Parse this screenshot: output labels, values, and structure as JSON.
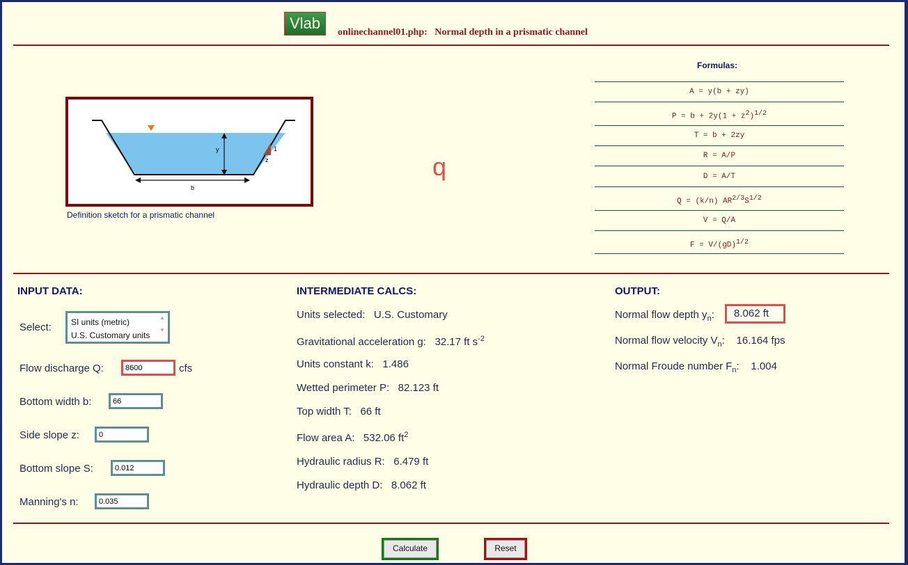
{
  "header": {
    "logo_text": "Vlab",
    "page_file": "onlinechannel01.php:",
    "page_title": "Normal depth in a prismatic channel"
  },
  "sketch": {
    "caption": "Definition sketch for a prismatic channel",
    "label_y": "y",
    "label_b": "b",
    "label_z": "z",
    "label_1": "1"
  },
  "big_symbol": "q",
  "formulas": {
    "title": "Formulas:",
    "rows": [
      {
        "main": "A = y(b + zy)"
      },
      {
        "main": "P = b + 2y(1 + z",
        "sup": "2",
        "tail": ")",
        "sup2": "1/2"
      },
      {
        "main": "T = b + 2zy"
      },
      {
        "main": "R = A/P"
      },
      {
        "main": "D = A/T"
      },
      {
        "main": "Q = (k/n) AR",
        "sup": "2/3",
        "tail": "S",
        "sup2": "1/2"
      },
      {
        "main": "V = Q/A"
      },
      {
        "main": "F = V/(gD)",
        "sup": "1/2"
      }
    ]
  },
  "input": {
    "title": "INPUT DATA:",
    "select_label": "Select:",
    "unit_options": [
      "SI units (metric)",
      "U.S. Customary units"
    ],
    "flow_label": "Flow discharge Q:",
    "flow_value": "8600",
    "flow_unit": "cfs",
    "bottom_width_label": "Bottom width b:",
    "bottom_width_value": "66",
    "side_slope_label": "Side slope z:",
    "side_slope_value": "0",
    "bottom_slope_label": "Bottom slope S:",
    "bottom_slope_value": "0.012",
    "manning_label": "Manning's n:",
    "manning_value": "0.035"
  },
  "intermediate": {
    "title": "INTERMEDIATE CALCS:",
    "units_label": "Units selected:",
    "units_value": "U.S. Customary",
    "g_label": "Gravitational acceleration g:",
    "g_value": "32.17 ft s",
    "g_exp": "-2",
    "k_label": "Units constant k:",
    "k_value": "1.486",
    "p_label": "Wetted perimeter P:",
    "p_value": "82.123 ft",
    "t_label": "Top width T:",
    "t_value": "66 ft",
    "a_label": "Flow area A:",
    "a_value": "532.06 ft",
    "a_exp": "2",
    "r_label": "Hydraulic radius R:",
    "r_value": "6.479 ft",
    "d_label": "Hydraulic depth D:",
    "d_value": "8.062 ft"
  },
  "output": {
    "title": "OUTPUT:",
    "depth_label": "Normal flow depth y",
    "depth_sub": "n",
    "depth_value": "8.062 ft",
    "velocity_label": "Normal flow velocity V",
    "velocity_sub": "n",
    "velocity_value": "16.164 fps",
    "froude_label": "Normal Froude number F",
    "froude_sub": "n",
    "froude_value": "1.004"
  },
  "buttons": {
    "calculate": "Calculate",
    "reset": "Reset"
  }
}
